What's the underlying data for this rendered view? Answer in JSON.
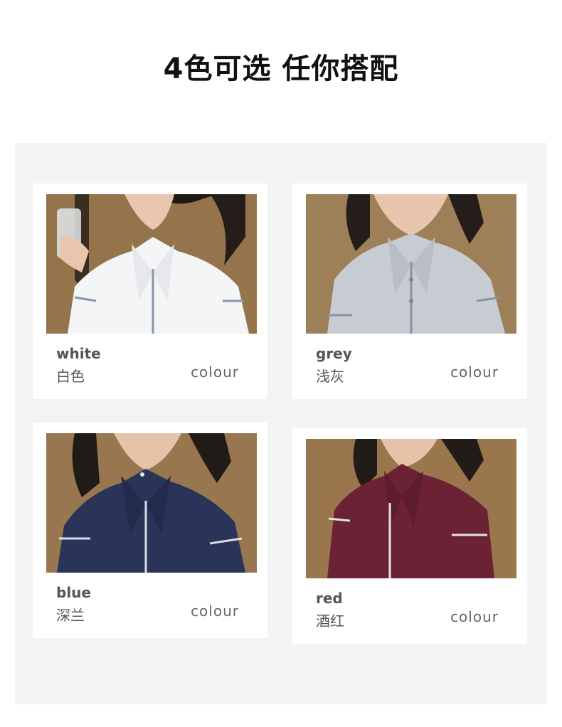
{
  "headline": "4色可选 任你搭配",
  "colors": {
    "panel_bg": "#f3f3f3",
    "card_bg": "#ffffff",
    "text_dark": "#111111",
    "text_label": "#555555"
  },
  "cards": [
    {
      "name_en": "white",
      "name_cn": "白色",
      "colour_label": "colour",
      "shirt_color": "#f4f5f7",
      "trim_color": "#8a94a8",
      "image": "woman-in-white-short-sleeve-shirt"
    },
    {
      "name_en": "grey",
      "name_cn": "浅灰",
      "colour_label": "colour",
      "shirt_color": "#c7ccd2",
      "trim_color": "#8891a0",
      "image": "woman-in-grey-short-sleeve-shirt"
    },
    {
      "name_en": "blue",
      "name_cn": "深兰",
      "colour_label": "colour",
      "shirt_color": "#2a3358",
      "trim_color": "#d9dce6",
      "image": "woman-in-navy-short-sleeve-shirt"
    },
    {
      "name_en": "red",
      "name_cn": "酒红",
      "colour_label": "colour",
      "shirt_color": "#6b2235",
      "trim_color": "#e2e2e8",
      "image": "woman-in-burgundy-short-sleeve-shirt"
    }
  ]
}
